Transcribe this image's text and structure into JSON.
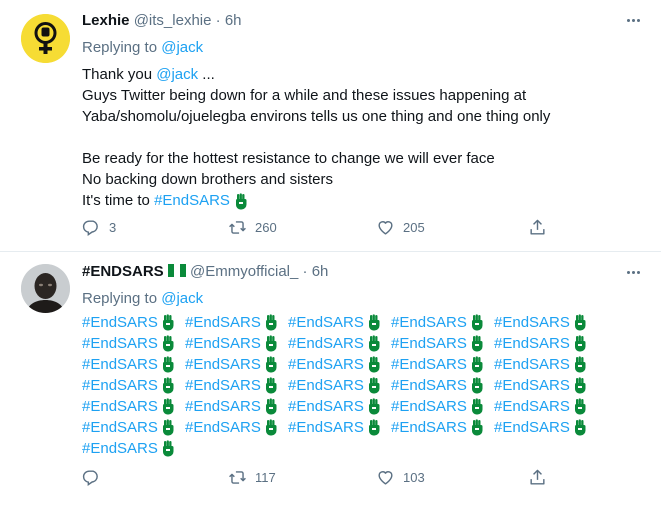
{
  "tweets": [
    {
      "name": "Lexhie",
      "handle": "@its_lexhie",
      "time": "6h",
      "replying_prefix": "Replying to ",
      "replying_to": "@jack",
      "body": {
        "thanks_prefix": "Thank you ",
        "thanks_mention": "@jack",
        "thanks_suffix": " ...",
        "line2": "Guys Twitter being down for a while and these issues happening at",
        "line3": "Yaba/shomolu/ojuelegba environs tells us one thing and one thing only",
        "line4": "Be ready for the hottest resistance to change we will ever face",
        "line5": "No backing down brothers and sisters",
        "line6_prefix": "It's time to ",
        "line6_tag": "#EndSARS"
      },
      "stats": {
        "replies": "3",
        "retweets": "260",
        "likes": "205"
      }
    },
    {
      "name": "#ENDSARS",
      "flag_icon": "nigeria-flag-icon",
      "handle": "@Emmyofficial_",
      "time": "6h",
      "replying_prefix": "Replying to ",
      "replying_to": "@jack",
      "hashtag": "#EndSARS",
      "hashtag_rows": 6,
      "hashtag_cols": 5,
      "hashtag_extra": 1,
      "stats": {
        "replies": "",
        "retweets": "117",
        "likes": "103"
      }
    }
  ],
  "colors": {
    "link": "#1da1f2",
    "muted": "#5b7083",
    "text": "#0f1419",
    "fist_green": "#0a8a3a"
  }
}
